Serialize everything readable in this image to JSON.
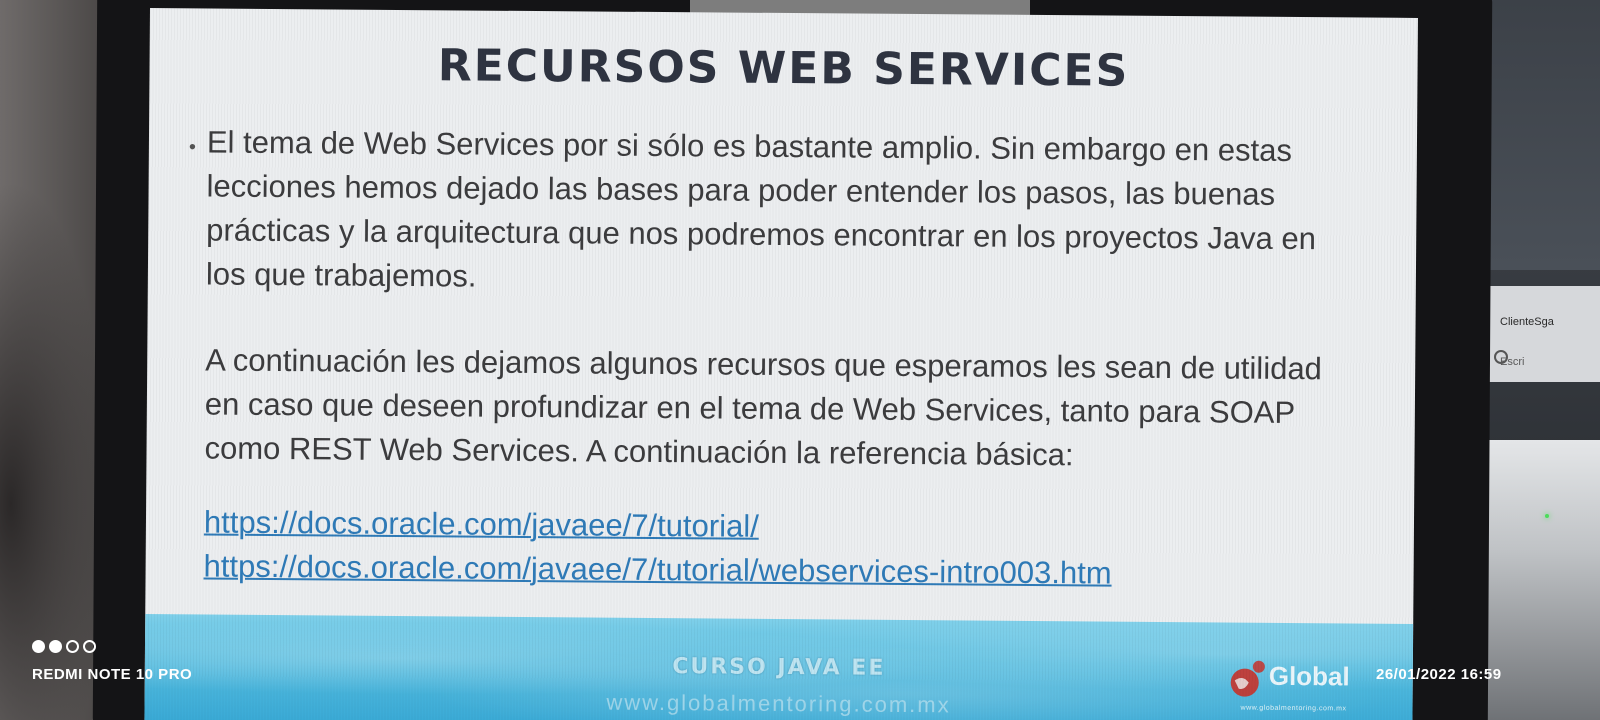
{
  "slide": {
    "title": "RECURSOS WEB SERVICES",
    "paragraph_1": "El tema de Web Services por si sólo es bastante amplio. Sin embargo en estas lecciones hemos dejado las bases para poder entender los pasos, las buenas prácticas y la arquitectura que nos podremos encontrar en los proyectos Java en los que trabajemos.",
    "paragraph_2": "A continuación les dejamos algunos recursos que esperamos les sean de utilidad en caso que deseen profundizar en el tema de Web Services, tanto para SOAP como REST Web Services.  A continuación la referencia básica:",
    "links": [
      "https://docs.oracle.com/javaee/7/tutorial/",
      "https://docs.oracle.com/javaee/7/tutorial/webservices-intro003.htm"
    ],
    "footer": {
      "course": "CURSO JAVA EE",
      "site": "www.globalmentoring.com.mx",
      "logo_text": "Global",
      "logo_sub": "www.globalmentoring.com.mx"
    }
  },
  "taskbar": {
    "item_1": "ClienteSga",
    "item_2": "Escri"
  },
  "watermark": {
    "device": "REDMI NOTE 10 PRO",
    "datetime": "26/01/2022 16:59"
  },
  "colors": {
    "title": "#2f3441",
    "body_text": "#3c3c3e",
    "link": "#2f7bb8",
    "footer": "#55bde0"
  }
}
